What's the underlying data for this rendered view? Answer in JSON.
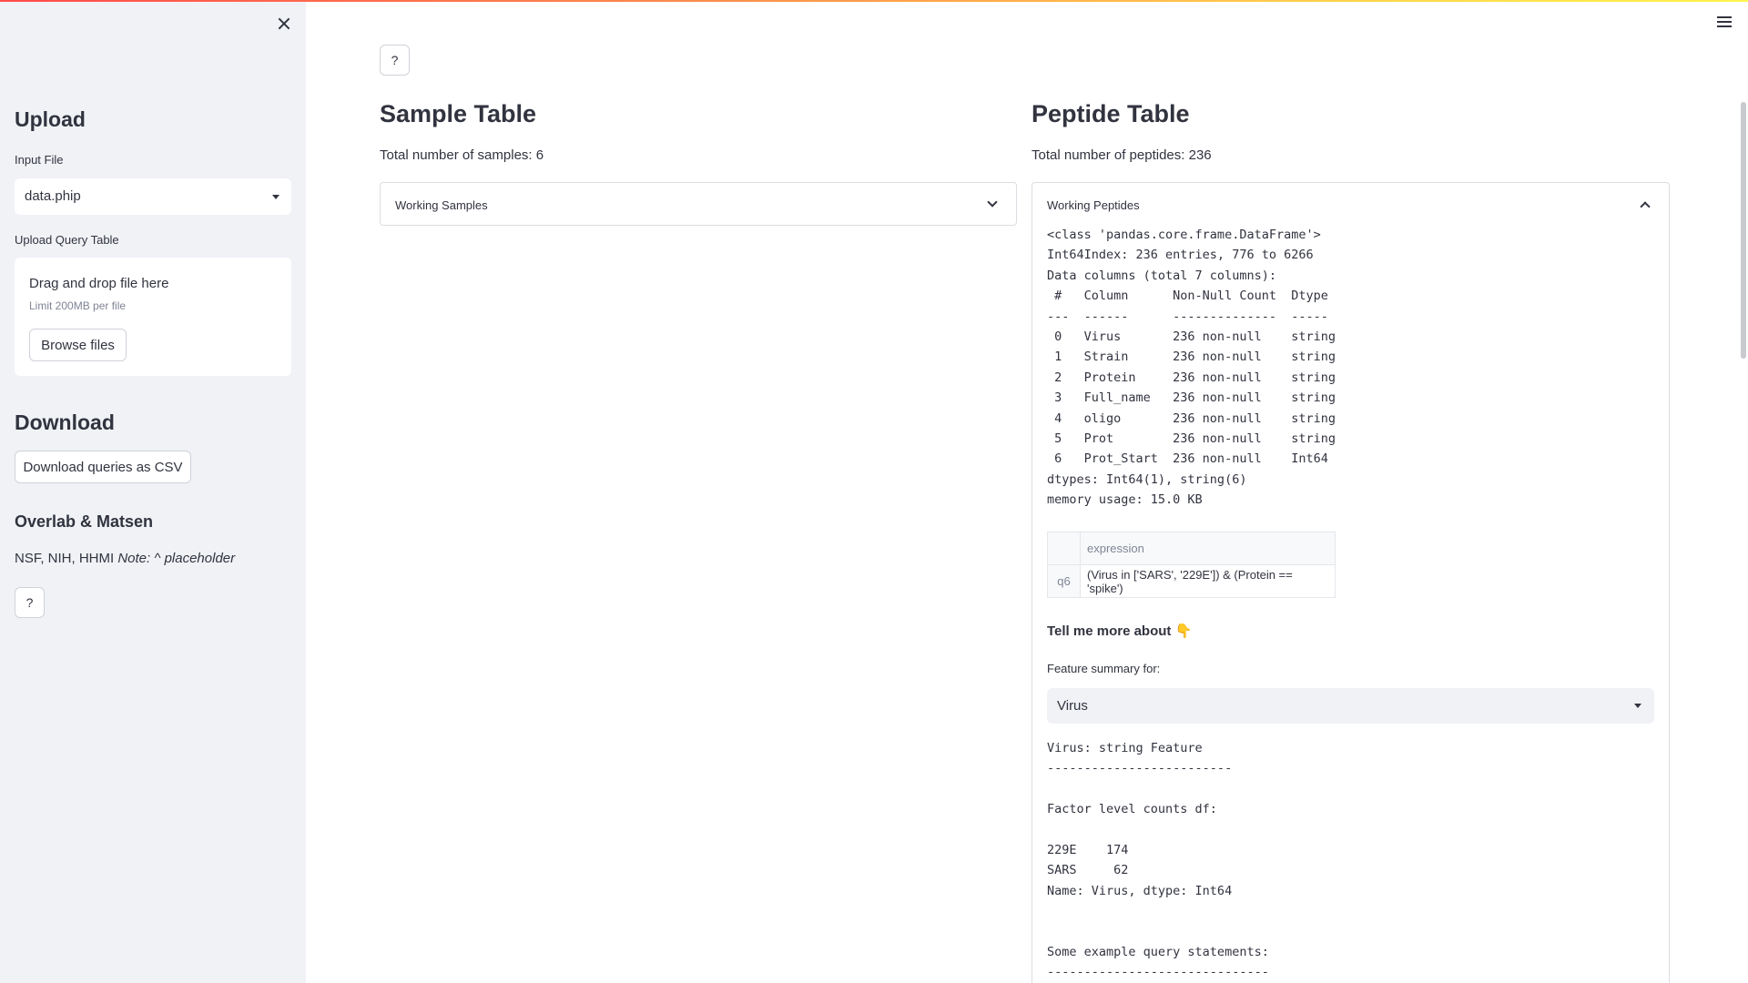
{
  "sidebar": {
    "upload_heading": "Upload",
    "input_file_label": "Input File",
    "input_file_value": "data.phip",
    "query_table_label": "Upload Query Table",
    "dropzone_title": "Drag and drop file here",
    "dropzone_limit": "Limit 200MB per file",
    "browse_button": "Browse files",
    "download_heading": "Download",
    "download_button": "Download queries as CSV",
    "credits_heading": "Overlab & Matsen",
    "credits_text": "NSF, NIH, HHMI",
    "credits_note": "Note: ^ placeholder",
    "help_button": "?"
  },
  "main": {
    "help_button": "?",
    "sample": {
      "heading": "Sample Table",
      "count": "Total number of samples: 6",
      "expander_label": "Working Samples"
    },
    "peptide": {
      "heading": "Peptide Table",
      "count": "Total number of peptides: 236",
      "expander_label": "Working Peptides",
      "info_lines": [
        "<class 'pandas.core.frame.DataFrame'>",
        "Int64Index: 236 entries, 776 to 6266",
        "Data columns (total 7 columns):",
        " #   Column      Non-Null Count  Dtype",
        "---  ------      --------------  -----",
        " 0   Virus       236 non-null    string",
        " 1   Strain      236 non-null    string",
        " 2   Protein     236 non-null    string",
        " 3   Full_name   236 non-null    string",
        " 4   oligo       236 non-null    string",
        " 5   Prot        236 non-null    string",
        " 6   Prot_Start  236 non-null    Int64",
        "dtypes: Int64(1), string(6)",
        "memory usage: 15.0 KB"
      ],
      "query_table": {
        "column_header": "expression",
        "row_index": "q6",
        "row_value": "(Virus in ['SARS', '229E']) & (Protein == 'spike')"
      },
      "tell_me_more": "Tell me more about 👇",
      "feature_label": "Feature summary for:",
      "feature_value": "Virus",
      "summary_lines": [
        "Virus: string Feature",
        "-------------------------",
        "",
        "Factor level counts df:",
        "",
        "229E    174",
        "SARS     62",
        "Name: Virus, dtype: Int64",
        "",
        "",
        "Some example query statements:",
        "------------------------------"
      ]
    }
  }
}
